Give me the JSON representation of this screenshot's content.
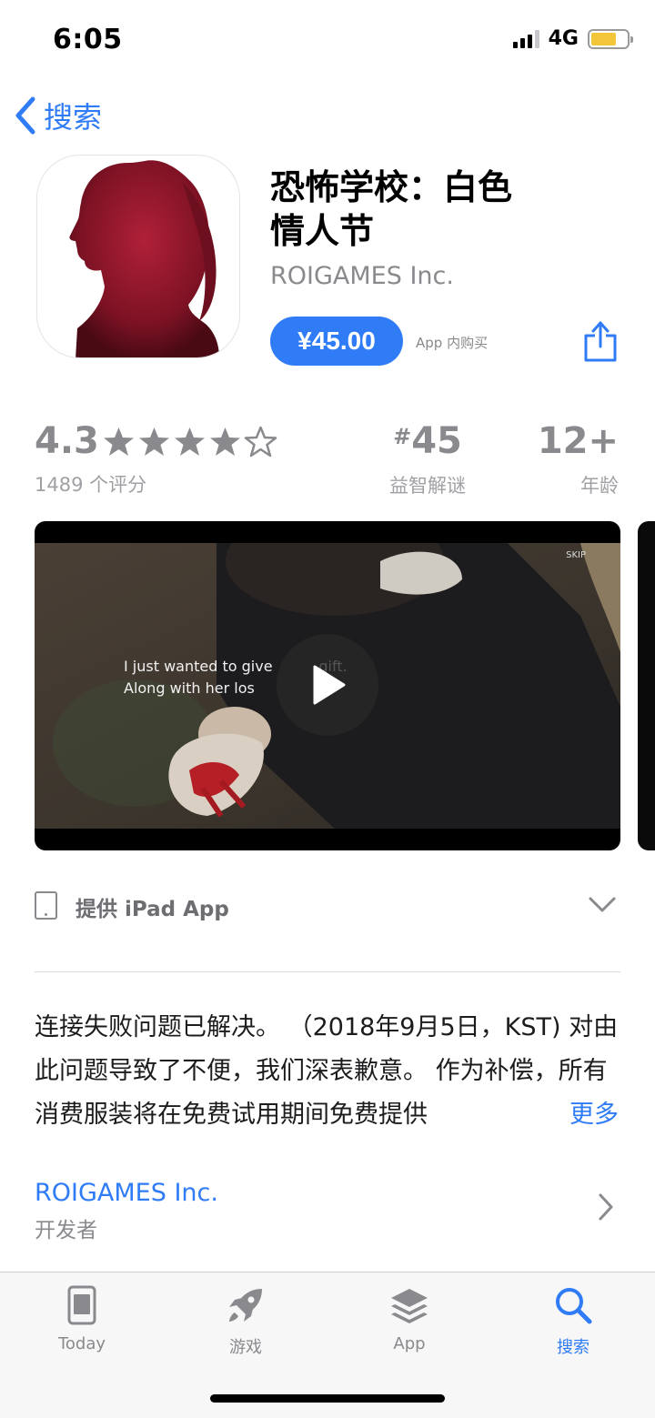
{
  "status_bar": {
    "time": "6:05",
    "network": "4G"
  },
  "nav": {
    "back_label": "搜索"
  },
  "app": {
    "title_line1": "恐怖学校：白色",
    "title_line2": "情人节",
    "developer": "ROIGAMES Inc.",
    "price": "¥45.00",
    "iap_note": "App 内购买"
  },
  "ratings": {
    "score": "4.3",
    "stars": 4,
    "stars_max": 5,
    "count_label": "1489 个评分",
    "rank_hash": "#",
    "rank": "45",
    "category": "益智解谜",
    "age": "12+",
    "age_label": "年龄"
  },
  "video": {
    "skip": "SKIP",
    "subtitle_line1": "I just wanted to give          gift.",
    "subtitle_line2": "Along with her los"
  },
  "device_row": {
    "label": "提供 iPad App"
  },
  "description": {
    "text": "连接失败问题已解决。 （2018年9月5日，KST) 对由此问题导致了不便，我们深表歉意。 作为补偿，所有消费服装将在免费试用期间免费提供",
    "more": "更多"
  },
  "developer_row": {
    "name": "ROIGAMES Inc.",
    "role": "开发者"
  },
  "tabbar": {
    "items": [
      {
        "label": "Today",
        "icon": "today-icon"
      },
      {
        "label": "游戏",
        "icon": "rocket-icon"
      },
      {
        "label": "App",
        "icon": "layers-icon"
      },
      {
        "label": "搜索",
        "icon": "search-icon"
      }
    ],
    "active_index": 3
  },
  "colors": {
    "accent": "#2f7cf6",
    "battery": "#f3c63a",
    "icon_red": "#8e1628"
  }
}
